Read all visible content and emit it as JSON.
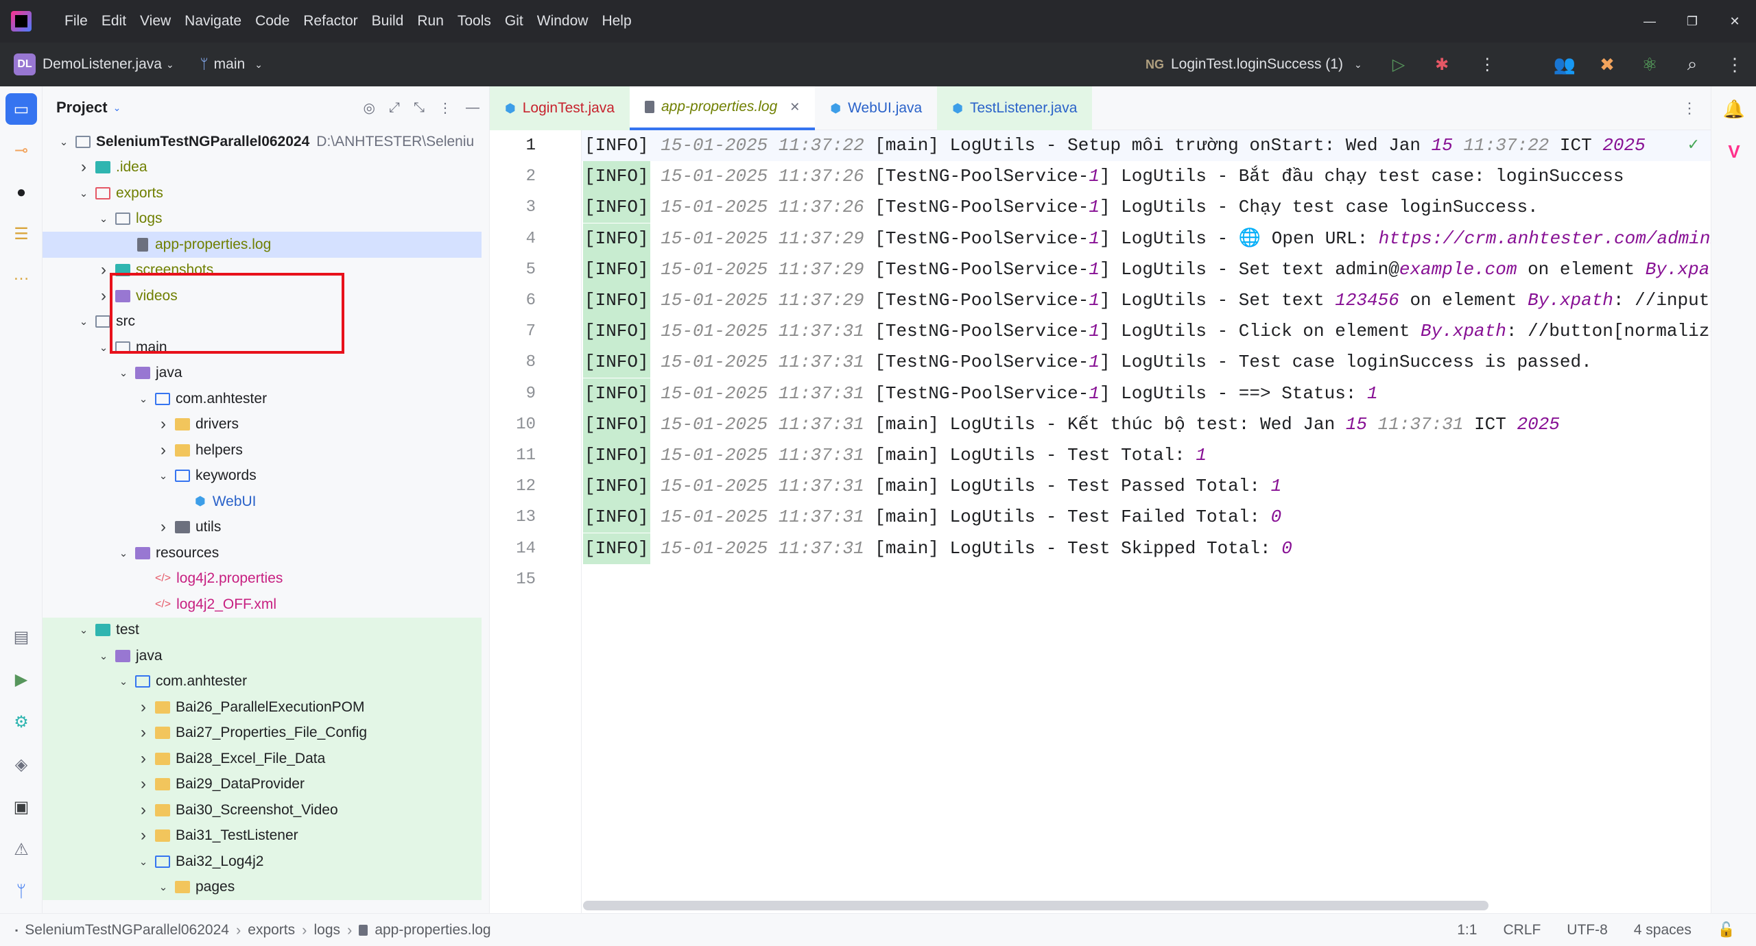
{
  "menu": [
    "File",
    "Edit",
    "View",
    "Navigate",
    "Code",
    "Refactor",
    "Build",
    "Run",
    "Tools",
    "Git",
    "Window",
    "Help"
  ],
  "window_controls": [
    "—",
    "❐",
    "✕"
  ],
  "toolbar": {
    "project_badge": "DL",
    "project_name": "DemoListener.java",
    "branch": "main",
    "run_config": "LoginTest.loginSuccess (1)"
  },
  "project_panel": {
    "title": "Project",
    "tree": [
      {
        "label": "SeleniumTestNGParallel062024",
        "extra": "D:\\ANHTESTER\\Seleniu",
        "indent": 0,
        "chev": "v",
        "icon": "folder-o",
        "style": "bold"
      },
      {
        "label": ".idea",
        "indent": 1,
        "chev": ">",
        "icon": "folder-teal",
        "style": "olive"
      },
      {
        "label": "exports",
        "indent": 1,
        "chev": "v",
        "icon": "folder-red",
        "style": "olive"
      },
      {
        "label": "logs",
        "indent": 2,
        "chev": "v",
        "icon": "folder-o",
        "style": "olive"
      },
      {
        "label": "app-properties.log",
        "indent": 3,
        "chev": "",
        "icon": "file",
        "style": "olive",
        "selected": true
      },
      {
        "label": "screenshots",
        "indent": 2,
        "chev": ">",
        "icon": "folder-teal",
        "style": "olive"
      },
      {
        "label": "videos",
        "indent": 2,
        "chev": ">",
        "icon": "folder-purple",
        "style": "olive"
      },
      {
        "label": "src",
        "indent": 1,
        "chev": "v",
        "icon": "folder-o",
        "style": ""
      },
      {
        "label": "main",
        "indent": 2,
        "chev": "v",
        "icon": "folder-o",
        "style": ""
      },
      {
        "label": "java",
        "indent": 3,
        "chev": "v",
        "icon": "folder-purple",
        "style": ""
      },
      {
        "label": "com.anhtester",
        "indent": 4,
        "chev": "v",
        "icon": "folder-blue",
        "style": ""
      },
      {
        "label": "drivers",
        "indent": 5,
        "chev": ">",
        "icon": "folder-y",
        "style": ""
      },
      {
        "label": "helpers",
        "indent": 5,
        "chev": ">",
        "icon": "folder-y",
        "style": ""
      },
      {
        "label": "keywords",
        "indent": 5,
        "chev": "v",
        "icon": "folder-blue",
        "style": ""
      },
      {
        "label": "WebUI",
        "indent": 6,
        "chev": "",
        "icon": "cube",
        "style": "blue"
      },
      {
        "label": "utils",
        "indent": 5,
        "chev": ">",
        "icon": "folder-gray",
        "style": ""
      },
      {
        "label": "resources",
        "indent": 3,
        "chev": "v",
        "icon": "folder-purple",
        "style": ""
      },
      {
        "label": "log4j2.properties",
        "indent": 4,
        "chev": "",
        "icon": "xml",
        "style": "pink"
      },
      {
        "label": "log4j2_OFF.xml",
        "indent": 4,
        "chev": "",
        "icon": "xml",
        "style": "pink"
      },
      {
        "label": "test",
        "indent": 1,
        "chev": "v",
        "icon": "folder-teal",
        "style": "",
        "green": true
      },
      {
        "label": "java",
        "indent": 2,
        "chev": "v",
        "icon": "folder-purple",
        "style": "",
        "green": true
      },
      {
        "label": "com.anhtester",
        "indent": 3,
        "chev": "v",
        "icon": "folder-blue",
        "style": "",
        "green": true
      },
      {
        "label": "Bai26_ParallelExecutionPOM",
        "indent": 4,
        "chev": ">",
        "icon": "folder-y",
        "style": "",
        "green": true
      },
      {
        "label": "Bai27_Properties_File_Config",
        "indent": 4,
        "chev": ">",
        "icon": "folder-y",
        "style": "",
        "green": true
      },
      {
        "label": "Bai28_Excel_File_Data",
        "indent": 4,
        "chev": ">",
        "icon": "folder-y",
        "style": "",
        "green": true
      },
      {
        "label": "Bai29_DataProvider",
        "indent": 4,
        "chev": ">",
        "icon": "folder-y",
        "style": "",
        "green": true
      },
      {
        "label": "Bai30_Screenshot_Video",
        "indent": 4,
        "chev": ">",
        "icon": "folder-y",
        "style": "",
        "green": true
      },
      {
        "label": "Bai31_TestListener",
        "indent": 4,
        "chev": ">",
        "icon": "folder-y",
        "style": "",
        "green": true
      },
      {
        "label": "Bai32_Log4j2",
        "indent": 4,
        "chev": "v",
        "icon": "folder-blue",
        "style": "",
        "green": true
      },
      {
        "label": "pages",
        "indent": 5,
        "chev": "v",
        "icon": "folder-y",
        "style": "",
        "green": true
      }
    ]
  },
  "tabs": [
    {
      "label": "LoginTest.java",
      "icon": "cube",
      "green": true,
      "active": false
    },
    {
      "label": "app-properties.log",
      "icon": "doc",
      "green": false,
      "active": true,
      "close": "✕"
    },
    {
      "label": "WebUI.java",
      "icon": "cube",
      "green": false,
      "active": false
    },
    {
      "label": "TestListener.java",
      "icon": "cube",
      "green": true,
      "active": false
    }
  ],
  "editor": {
    "current_line": 1,
    "lines": [
      [
        [
          "info",
          "[INFO]"
        ],
        [
          "t",
          " "
        ],
        [
          "ts",
          "15-01-2025 11:37:22"
        ],
        [
          "t",
          " [main] LogUtils - Setup môi trường onStart: Wed Jan "
        ],
        [
          "num",
          "15"
        ],
        [
          "t",
          " "
        ],
        [
          "ts",
          "11:37:22"
        ],
        [
          "t",
          " ICT "
        ],
        [
          "num",
          "2025"
        ]
      ],
      [
        [
          "info",
          "[INFO]"
        ],
        [
          "t",
          " "
        ],
        [
          "ts",
          "15-01-2025 11:37:26"
        ],
        [
          "t",
          " [TestNG-PoolService-"
        ],
        [
          "num",
          "1"
        ],
        [
          "t",
          "] LogUtils - Bắt đầu chạy test case: loginSuccess"
        ]
      ],
      [
        [
          "info",
          "[INFO]"
        ],
        [
          "t",
          " "
        ],
        [
          "ts",
          "15-01-2025 11:37:26"
        ],
        [
          "t",
          " [TestNG-PoolService-"
        ],
        [
          "num",
          "1"
        ],
        [
          "t",
          "] LogUtils - Chạy test case loginSuccess."
        ]
      ],
      [
        [
          "info",
          "[INFO]"
        ],
        [
          "t",
          " "
        ],
        [
          "ts",
          "15-01-2025 11:37:29"
        ],
        [
          "t",
          " [TestNG-PoolService-"
        ],
        [
          "num",
          "1"
        ],
        [
          "t",
          "] LogUtils - 🌐 Open URL: "
        ],
        [
          "url",
          "https://crm.anhtester.com/admin/auth"
        ]
      ],
      [
        [
          "info",
          "[INFO]"
        ],
        [
          "t",
          " "
        ],
        [
          "ts",
          "15-01-2025 11:37:29"
        ],
        [
          "t",
          " [TestNG-PoolService-"
        ],
        [
          "num",
          "1"
        ],
        [
          "t",
          "] LogUtils - Set text admin@"
        ],
        [
          "url",
          "example.com"
        ],
        [
          "t",
          " on element "
        ],
        [
          "url",
          "By.xpath"
        ],
        [
          "t",
          ": /"
        ]
      ],
      [
        [
          "info",
          "[INFO]"
        ],
        [
          "t",
          " "
        ],
        [
          "ts",
          "15-01-2025 11:37:29"
        ],
        [
          "t",
          " [TestNG-PoolService-"
        ],
        [
          "num",
          "1"
        ],
        [
          "t",
          "] LogUtils - Set text "
        ],
        [
          "num",
          "123456"
        ],
        [
          "t",
          " on element "
        ],
        [
          "url",
          "By.xpath"
        ],
        [
          "t",
          ": //input[@id="
        ]
      ],
      [
        [
          "info",
          "[INFO]"
        ],
        [
          "t",
          " "
        ],
        [
          "ts",
          "15-01-2025 11:37:31"
        ],
        [
          "t",
          " [TestNG-PoolService-"
        ],
        [
          "num",
          "1"
        ],
        [
          "t",
          "] LogUtils - Click on element "
        ],
        [
          "url",
          "By.xpath"
        ],
        [
          "t",
          ": //button[normalize-spa"
        ]
      ],
      [
        [
          "info",
          "[INFO]"
        ],
        [
          "t",
          " "
        ],
        [
          "ts",
          "15-01-2025 11:37:31"
        ],
        [
          "t",
          " [TestNG-PoolService-"
        ],
        [
          "num",
          "1"
        ],
        [
          "t",
          "] LogUtils - Test case loginSuccess is passed."
        ]
      ],
      [
        [
          "info",
          "[INFO]"
        ],
        [
          "t",
          " "
        ],
        [
          "ts",
          "15-01-2025 11:37:31"
        ],
        [
          "t",
          " [TestNG-PoolService-"
        ],
        [
          "num",
          "1"
        ],
        [
          "t",
          "] LogUtils - ==> Status: "
        ],
        [
          "num",
          "1"
        ]
      ],
      [
        [
          "info",
          "[INFO]"
        ],
        [
          "t",
          " "
        ],
        [
          "ts",
          "15-01-2025 11:37:31"
        ],
        [
          "t",
          " [main] LogUtils - Kết thúc bộ test: Wed Jan "
        ],
        [
          "num",
          "15"
        ],
        [
          "t",
          " "
        ],
        [
          "ts",
          "11:37:31"
        ],
        [
          "t",
          " ICT "
        ],
        [
          "num",
          "2025"
        ]
      ],
      [
        [
          "info",
          "[INFO]"
        ],
        [
          "t",
          " "
        ],
        [
          "ts",
          "15-01-2025 11:37:31"
        ],
        [
          "t",
          " [main] LogUtils - Test Total: "
        ],
        [
          "num",
          "1"
        ]
      ],
      [
        [
          "info",
          "[INFO]"
        ],
        [
          "t",
          " "
        ],
        [
          "ts",
          "15-01-2025 11:37:31"
        ],
        [
          "t",
          " [main] LogUtils - Test Passed Total: "
        ],
        [
          "num",
          "1"
        ]
      ],
      [
        [
          "info",
          "[INFO]"
        ],
        [
          "t",
          " "
        ],
        [
          "ts",
          "15-01-2025 11:37:31"
        ],
        [
          "t",
          " [main] LogUtils - Test Failed Total: "
        ],
        [
          "num",
          "0"
        ]
      ],
      [
        [
          "info",
          "[INFO]"
        ],
        [
          "t",
          " "
        ],
        [
          "ts",
          "15-01-2025 11:37:31"
        ],
        [
          "t",
          " [main] LogUtils - Test Skipped Total: "
        ],
        [
          "num",
          "0"
        ]
      ],
      []
    ]
  },
  "statusbar": {
    "breadcrumbs": [
      "SeleniumTestNGParallel062024",
      "exports",
      "logs",
      "app-properties.log"
    ],
    "position": "1:1",
    "line_sep": "CRLF",
    "encoding": "UTF-8",
    "indent": "4 spaces"
  },
  "colors": {
    "accent": "#3574f0",
    "highlight_box": "#e8111b",
    "test_green": "#e3f6e6"
  }
}
